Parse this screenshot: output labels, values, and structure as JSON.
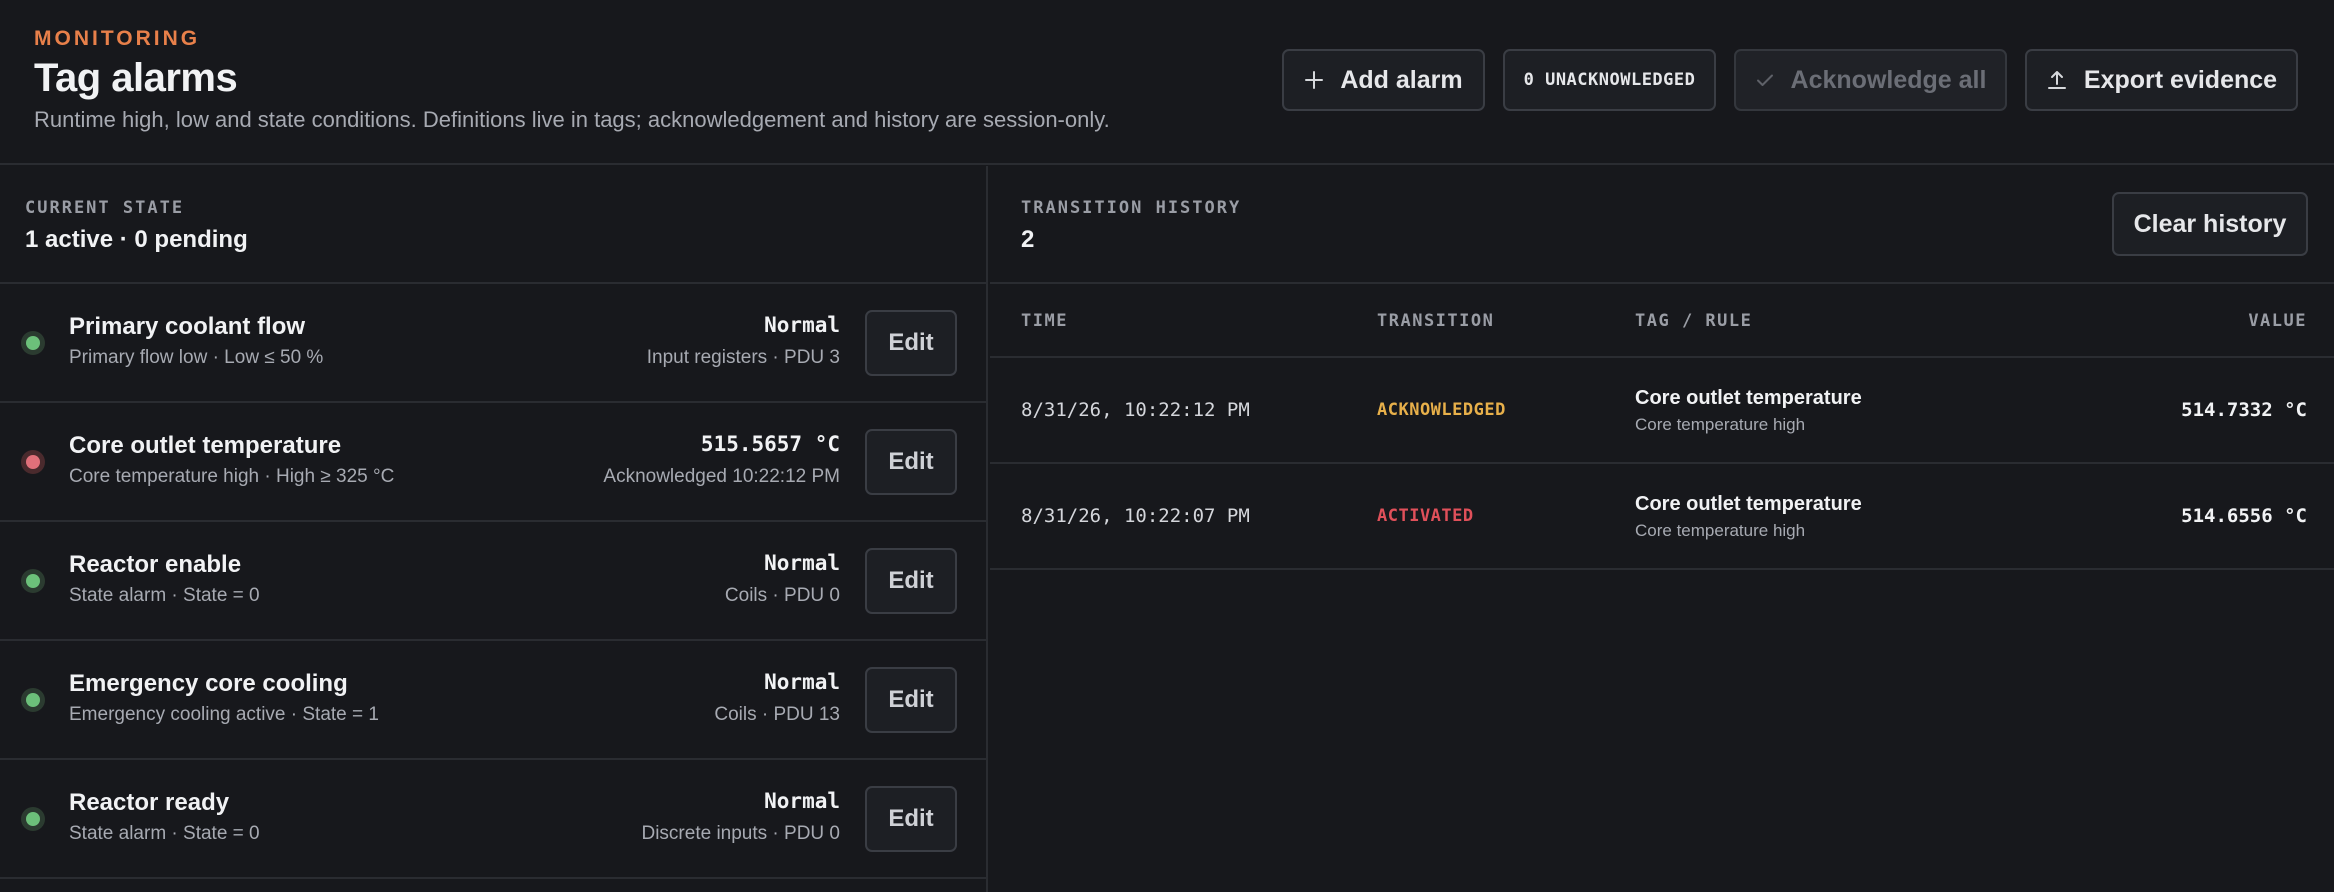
{
  "header": {
    "eyebrow": "MONITORING",
    "title": "Tag alarms",
    "subtitle": "Runtime high, low and state conditions. Definitions live in tags; acknowledgement and history are session-only.",
    "add_alarm": "Add alarm",
    "unacknowledged": "0 UNACKNOWLEDGED",
    "acknowledge_all": "Acknowledge all",
    "export_evidence": "Export evidence"
  },
  "current_state": {
    "label": "CURRENT STATE",
    "summary": "1 active · 0 pending",
    "edit_label": "Edit",
    "alarms": [
      {
        "name": "Primary coolant flow",
        "rule": "Primary flow low · Low ≤ 50 %",
        "value": "Normal",
        "source": "Input registers · PDU 3",
        "status": "ok"
      },
      {
        "name": "Core outlet temperature",
        "rule": "Core temperature high · High ≥ 325 °C",
        "value": "515.5657 °C",
        "source": "Acknowledged 10:22:12 PM",
        "status": "active"
      },
      {
        "name": "Reactor enable",
        "rule": "State alarm · State = 0",
        "value": "Normal",
        "source": "Coils · PDU 0",
        "status": "ok"
      },
      {
        "name": "Emergency core cooling",
        "rule": "Emergency cooling active · State = 1",
        "value": "Normal",
        "source": "Coils · PDU 13",
        "status": "ok"
      },
      {
        "name": "Reactor ready",
        "rule": "State alarm · State = 0",
        "value": "Normal",
        "source": "Discrete inputs · PDU 0",
        "status": "ok"
      }
    ]
  },
  "history": {
    "label": "TRANSITION HISTORY",
    "count": "2",
    "clear_label": "Clear history",
    "columns": {
      "time": "TIME",
      "transition": "TRANSITION",
      "tag_rule": "TAG / RULE",
      "value": "VALUE"
    },
    "rows": [
      {
        "time": "8/31/26, 10:22:12 PM",
        "transition": "ACKNOWLEDGED",
        "tag": "Core outlet temperature",
        "rule": "Core temperature high",
        "value": "514.7332 °C"
      },
      {
        "time": "8/31/26, 10:22:07 PM",
        "transition": "ACTIVATED",
        "tag": "Core outlet temperature",
        "rule": "Core temperature high",
        "value": "514.6556 °C"
      }
    ]
  },
  "colors": {
    "accent": "#e8804a",
    "ok": "#6cc07a",
    "alarm": "#e0707a",
    "acknowledged": "#e8b04a",
    "activated": "#e0505a"
  },
  "icons": {
    "add": "plus-icon",
    "acknowledge": "check-icon",
    "export": "upload-icon"
  }
}
